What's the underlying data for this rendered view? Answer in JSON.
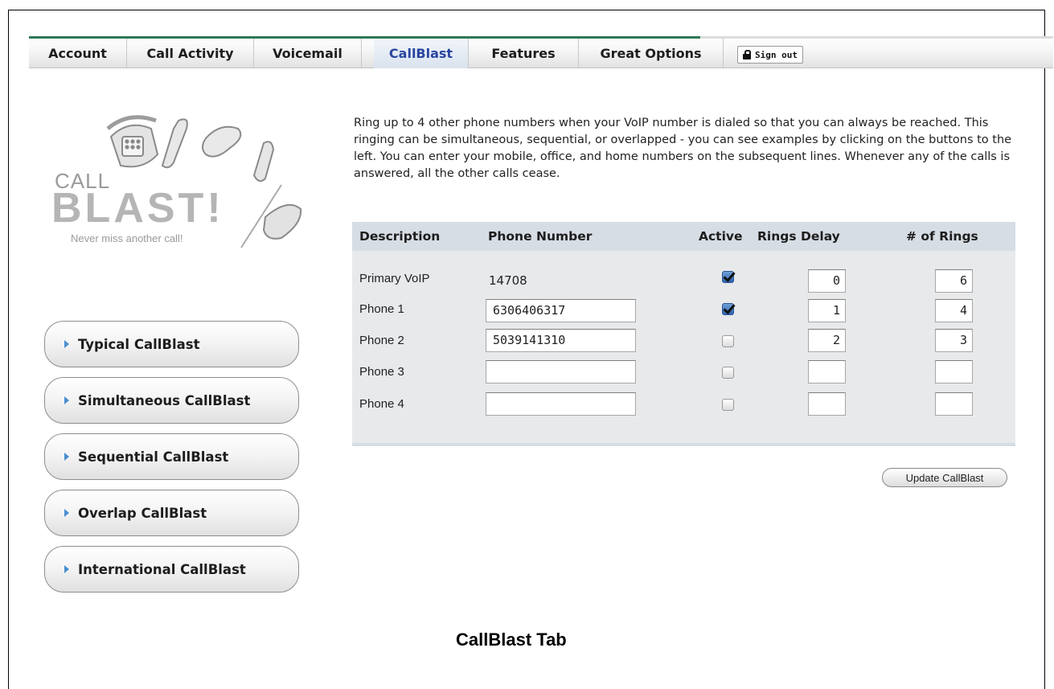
{
  "nav": {
    "tabs": [
      {
        "label": "Account"
      },
      {
        "label": "Call Activity"
      },
      {
        "label": "Voicemail"
      },
      {
        "label": "CallBlast",
        "active": true
      },
      {
        "label": "Features"
      },
      {
        "label": "Great Options"
      }
    ],
    "signout_label": "Sign out"
  },
  "logo": {
    "line1": "CALL",
    "line2": "BLAST!",
    "tagline": "Never miss another call!"
  },
  "intro_text": "Ring up to 4 other phone numbers when your VoIP number is dialed so that you can always be reached. This ringing can be simultaneous, sequential, or overlapped - you can see examples by clicking on the buttons to the left. You can enter your mobile, office, and home numbers on the subsequent lines. Whenever any of the calls is answered, all the other calls cease.",
  "table": {
    "headers": [
      "Description",
      "Phone Number",
      "Active",
      "Rings Delay",
      "# of Rings"
    ],
    "rows": [
      {
        "description": "Primary VoIP",
        "phone": "14708",
        "editable_phone": false,
        "active": true,
        "rings_delay": "0",
        "num_rings": "6"
      },
      {
        "description": "Phone 1",
        "phone": "6306406317",
        "editable_phone": true,
        "active": true,
        "rings_delay": "1",
        "num_rings": "4"
      },
      {
        "description": "Phone 2",
        "phone": "5039141310",
        "editable_phone": true,
        "active": false,
        "rings_delay": "2",
        "num_rings": "3"
      },
      {
        "description": "Phone 3",
        "phone": "",
        "editable_phone": true,
        "active": false,
        "rings_delay": "",
        "num_rings": ""
      },
      {
        "description": "Phone 4",
        "phone": "",
        "editable_phone": true,
        "active": false,
        "rings_delay": "",
        "num_rings": ""
      }
    ]
  },
  "examples": {
    "buttons": [
      {
        "label": "Typical CallBlast"
      },
      {
        "label": "Simultaneous CallBlast"
      },
      {
        "label": "Sequential CallBlast"
      },
      {
        "label": "Overlap CallBlast"
      },
      {
        "label": "International CallBlast"
      }
    ]
  },
  "update_button_label": "Update CallBlast",
  "caption": "CallBlast Tab"
}
